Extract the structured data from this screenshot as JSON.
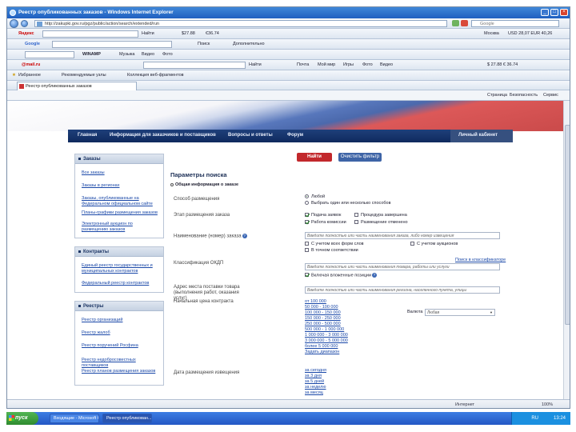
{
  "window": {
    "title": "Реестр опубликованных заказов - Windows Internet Explorer",
    "minimize": "_",
    "maximize": "□",
    "close": "×"
  },
  "address": {
    "url": "http://zakupki.gov.ru/pgz/public/action/search/extended/run",
    "search_placeholder": "Google"
  },
  "toolbars": {
    "yandex_logo": "Яндекс",
    "yandex_find": "Найти",
    "yandex_rates": [
      "$27.88",
      "€36.74"
    ],
    "google_label": "Google",
    "google_search": "Поиск",
    "google_more": "Дополнительно",
    "winamp": "WINAMP",
    "media": [
      "Музыка",
      "Видео",
      "Фото"
    ],
    "mail_logo": "@mail.ru",
    "mail_search": "Найти",
    "mail_links": [
      "Почта",
      "Мой мир",
      "Игры",
      "Фото",
      "Видео"
    ],
    "weather": "Москва",
    "currency_text": "USD 28,07  EUR 40,26",
    "cbr_rates": "$ 27.88  € 36.74",
    "favorites": "Избранное",
    "suggested_sites": "Рекомендуемые узлы",
    "webslice": "Коллекция веб-фрагментов",
    "tab_title": "Реестр опубликованных заказов",
    "cmd": [
      "Страница",
      "Безопасность",
      "Сервис"
    ]
  },
  "site": {
    "nav": [
      "Главная",
      "Информация для заказчиков и поставщиков",
      "Вопросы и ответы",
      "Форум"
    ],
    "account": "Личный кабинет",
    "panels": [
      {
        "title": "Заказы",
        "links": [
          "Все заказы",
          "Заказы в регионах",
          "Заказы, опубликованные на Федеральном официальном сайте",
          "Планы-графики размещения заказов",
          "Электронный аукцион по размещению заказов"
        ]
      },
      {
        "title": "Контракты",
        "links": [
          "Единый реестр государственных и муниципальных контрактов",
          "Федеральный реестр контрактов"
        ]
      },
      {
        "title": "Реестры",
        "links": [
          "Реестр организаций",
          "Реестр жалоб",
          "Реестр поручений Росфина",
          "Реестр недобросовестных поставщиков",
          "Реестр планов размещения заказов"
        ]
      }
    ],
    "buttons": {
      "find": "Найти",
      "clear": "Очистить фильтр"
    },
    "form": {
      "title": "Параметры поиска",
      "section": "Общая информация о заказе",
      "placing_label": "Способ размещения",
      "placing_opts": [
        "Любой",
        "Выбрать один или несколько способов"
      ],
      "stage_label": "Этап размещения заказа",
      "stage_opts": [
        "Подача заявок",
        "Работа комиссии",
        "Процедура завершена",
        "Размещение отменено"
      ],
      "name_label": "Наименование (номер) заказа",
      "name_placeholder": "Введите полностью или часть наименования заказа, либо номер извещения",
      "name_opts": [
        "С учетом всех форм слов",
        "С учетом аукционов",
        "В точном соответствии"
      ],
      "okdp_label": "Классификация ОКДП",
      "okdp_link": "Поиск в классификаторе",
      "okdp_placeholder": "Введите полностью или часть наименования товара, работы или услуги",
      "okdp_opt": "Включая вложенные позиции",
      "address_label": "Адрес места поставки товара (выполнения работ, оказания услуг)",
      "address_placeholder": "Введите полностью или часть наименования региона, населенного пункта, улицы",
      "price_label": "Начальная цена контракта",
      "price_opts": [
        "от 100 000",
        "50 000 - 100 000",
        "100 000 - 150 000",
        "150 000 - 250 000",
        "250 000 - 500 000",
        "500 000 - 1 000 000",
        "1 000 000 - 3 000 000",
        "3 000 000 - 5 000 000",
        "более 5 000 000",
        "Задать диапазон"
      ],
      "currency_label": "Валюта",
      "currency_value": "Любая",
      "date_label": "Дата размещения извещения",
      "date_opts": [
        "за сегодня",
        "за 3 дня",
        "за 5 дней",
        "за неделю",
        "за месяц"
      ]
    }
  },
  "status": {
    "text": "Интернет",
    "zoom": "100%"
  },
  "taskbar": {
    "start": "пуск",
    "tasks": [
      "Входящие - Microsoft Outlook",
      "Реестр опубликован..."
    ],
    "clock": "13:24",
    "lang": "RU"
  }
}
